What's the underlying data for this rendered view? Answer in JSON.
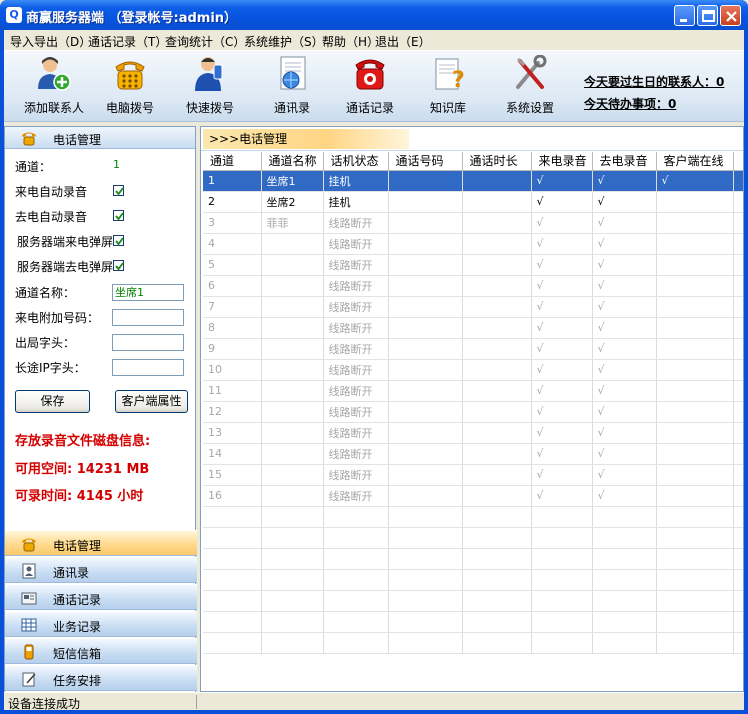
{
  "window": {
    "title": "商赢服务器端 （登录帐号:admin）"
  },
  "menu": [
    "导入导出（D）",
    "通话记录（T）",
    "查询统计（C）",
    "系统维护（S）",
    "帮助（H）",
    "退出（E）"
  ],
  "toolbar": {
    "buttons": [
      "添加联系人",
      "电脑拨号",
      "快速拨号",
      "通讯录",
      "通话记录",
      "知识库",
      "系统设置"
    ]
  },
  "notices": {
    "birthday": "今天要过生日的联系人：0",
    "todo": "今天待办事项：0"
  },
  "left": {
    "header": "电话管理",
    "channel_label": "通道：",
    "channel_value": "1",
    "checks": [
      {
        "label": "来电自动录音",
        "checked": true
      },
      {
        "label": "去电自动录音",
        "checked": true
      },
      {
        "label": "服务器端来电弹屏",
        "checked": true
      },
      {
        "label": "服务器端去电弹屏",
        "checked": true
      }
    ],
    "fields": [
      {
        "label": "通道名称：",
        "value": "坐席1"
      },
      {
        "label": "来电附加号码：",
        "value": ""
      },
      {
        "label": "出局字头：",
        "value": ""
      },
      {
        "label": "长途IP字头：",
        "value": ""
      }
    ],
    "save_button": "保存",
    "client_props_button": "客户端属性",
    "disk_title": "存放录音文件磁盘信息:",
    "free_space": "可用空间: 14231 MB",
    "record_time": "可录时间: 4145 小时"
  },
  "nav": [
    "电话管理",
    "通讯录",
    "通话记录",
    "业务记录",
    "短信信箱",
    "任务安排"
  ],
  "right": {
    "tab": ">>>电话管理",
    "columns": [
      "通道",
      "通道名称",
      "话机状态",
      "通话号码",
      "通话时长",
      "来电录音",
      "去电录音",
      "客户端在线"
    ],
    "rows": [
      [
        "1",
        "坐席1",
        "挂机",
        "",
        "",
        "√",
        "√",
        "√"
      ],
      [
        "2",
        "坐席2",
        "挂机",
        "",
        "",
        "√",
        "√",
        ""
      ],
      [
        "3",
        "菲菲",
        "线路断开",
        "",
        "",
        "√",
        "√",
        ""
      ],
      [
        "4",
        "",
        "线路断开",
        "",
        "",
        "√",
        "√",
        ""
      ],
      [
        "5",
        "",
        "线路断开",
        "",
        "",
        "√",
        "√",
        ""
      ],
      [
        "6",
        "",
        "线路断开",
        "",
        "",
        "√",
        "√",
        ""
      ],
      [
        "7",
        "",
        "线路断开",
        "",
        "",
        "√",
        "√",
        ""
      ],
      [
        "8",
        "",
        "线路断开",
        "",
        "",
        "√",
        "√",
        ""
      ],
      [
        "9",
        "",
        "线路断开",
        "",
        "",
        "√",
        "√",
        ""
      ],
      [
        "10",
        "",
        "线路断开",
        "",
        "",
        "√",
        "√",
        ""
      ],
      [
        "11",
        "",
        "线路断开",
        "",
        "",
        "√",
        "√",
        ""
      ],
      [
        "12",
        "",
        "线路断开",
        "",
        "",
        "√",
        "√",
        ""
      ],
      [
        "13",
        "",
        "线路断开",
        "",
        "",
        "√",
        "√",
        ""
      ],
      [
        "14",
        "",
        "线路断开",
        "",
        "",
        "√",
        "√",
        ""
      ],
      [
        "15",
        "",
        "线路断开",
        "",
        "",
        "√",
        "√",
        ""
      ],
      [
        "16",
        "",
        "线路断开",
        "",
        "",
        "√",
        "√",
        ""
      ]
    ]
  },
  "status": {
    "text": "设备连接成功"
  },
  "colors": {
    "title_blue": "#0654e0",
    "selection": "#316ac5",
    "disk_red": "#d40000",
    "nav_active": "#ffd88a"
  }
}
